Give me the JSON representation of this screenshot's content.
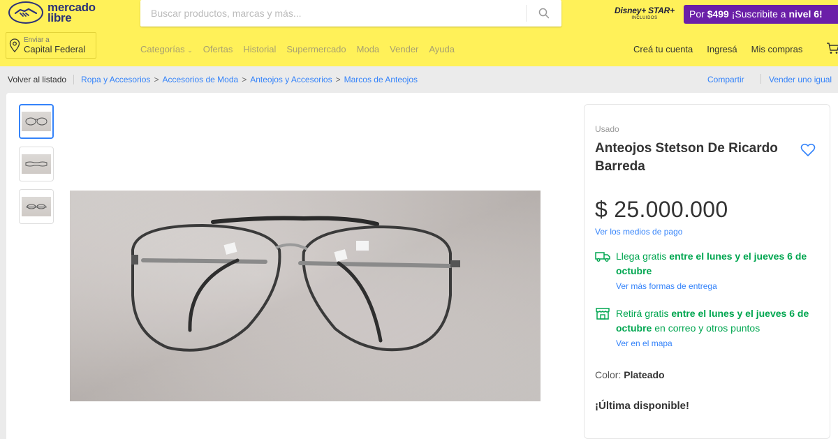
{
  "header": {
    "logo": {
      "line1": "mercado",
      "line2": "libre"
    },
    "search": {
      "placeholder": "Buscar productos, marcas y más..."
    },
    "disney": {
      "logo": "Disney+ STAR+",
      "sub": "INCLUIDOS"
    },
    "promo": {
      "prefix": "Por ",
      "price": "$499",
      "text": " ¡Suscribite a ",
      "level": "nivel 6!"
    },
    "location": {
      "small": "Enviar a",
      "big": "Capital Federal"
    },
    "nav": [
      "Categorías",
      "Ofertas",
      "Historial",
      "Supermercado",
      "Moda",
      "Vender",
      "Ayuda"
    ],
    "account": [
      "Creá tu cuenta",
      "Ingresá",
      "Mis compras"
    ]
  },
  "breadcrumb": {
    "back": "Volver al listado",
    "path": [
      "Ropa y Accesorios",
      "Accesorios de Moda",
      "Anteojos y Accesorios",
      "Marcos de Anteojos"
    ],
    "share": "Compartir",
    "sell": "Vender uno igual"
  },
  "product": {
    "condition": "Usado",
    "title": "Anteojos Stetson De Ricardo Barreda",
    "price": "$ 25.000.000",
    "payment_link": "Ver los medios de pago",
    "shipping": {
      "free_label": "Llega gratis",
      "dates": " entre el lunes y el jueves 6 de octubre",
      "link": "Ver más formas de entrega"
    },
    "pickup": {
      "free_label": "Retirá gratis",
      "dates": " entre el lunes y el jueves 6 de octubre",
      "rest": " en correo y otros puntos",
      "link": "Ver en el mapa"
    },
    "color_label": "Color: ",
    "color_value": "Plateado",
    "stock": "¡Última disponible!"
  },
  "colors": {
    "header_bg": "#fff159",
    "brand_navy": "#2d3277",
    "link_blue": "#3483fa",
    "ship_green": "#00a650",
    "promo_purple": "#6b1fa8"
  }
}
